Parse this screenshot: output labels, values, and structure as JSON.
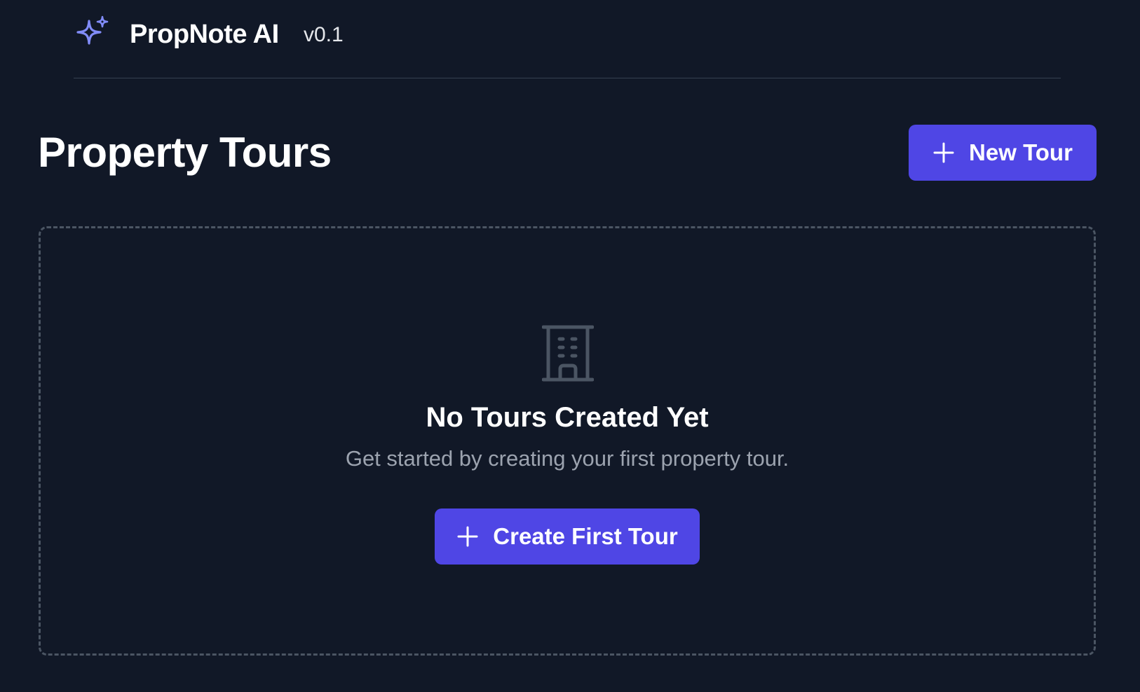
{
  "header": {
    "app_name": "PropNote AI",
    "version": "v0.1",
    "logo_icon": "sparkles-icon"
  },
  "main": {
    "title": "Property Tours",
    "new_tour_label": "New Tour",
    "new_tour_icon": "plus-icon"
  },
  "empty_state": {
    "icon": "building-icon",
    "title": "No Tours Created Yet",
    "subtitle": "Get started by creating your first property tour.",
    "cta_label": "Create First Tour",
    "cta_icon": "plus-icon"
  },
  "colors": {
    "background": "#111827",
    "accent": "#4f46e5",
    "logo": "#818cf8",
    "muted_text": "#9ca3af",
    "border": "#4b5563",
    "icon_gray": "#4b5563"
  }
}
